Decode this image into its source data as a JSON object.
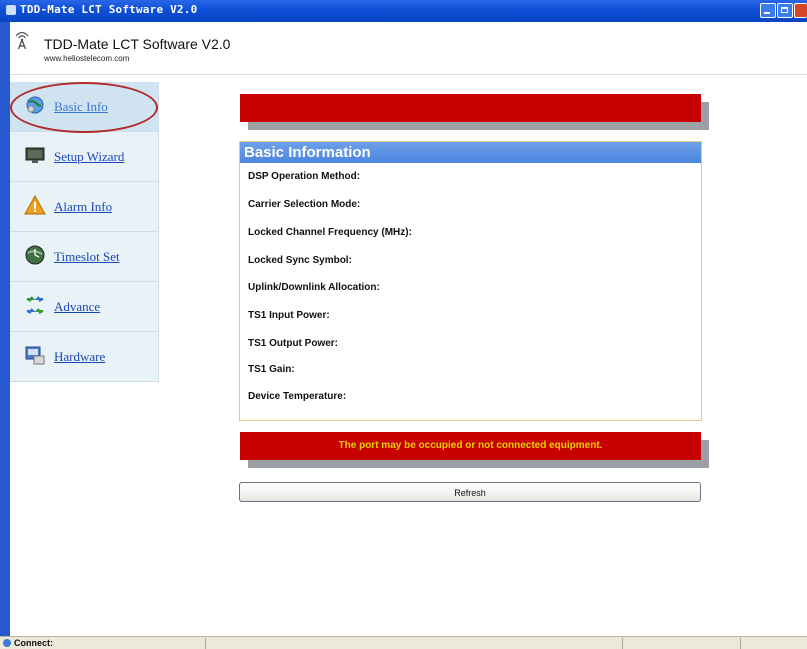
{
  "window": {
    "title": "TDD-Mate LCT Software V2.0"
  },
  "header": {
    "app_title": "TDD-Mate LCT Software V2.0",
    "url": "www.heliostelecom.com"
  },
  "sidebar": {
    "items": [
      {
        "label": "Basic Info",
        "icon": "globe-icon"
      },
      {
        "label": "Setup Wizard",
        "icon": "monitor-icon"
      },
      {
        "label": "Alarm Info",
        "icon": "warning-icon"
      },
      {
        "label": "Timeslot Set",
        "icon": "clock-globe-icon"
      },
      {
        "label": "Advance",
        "icon": "arrows-icon"
      },
      {
        "label": "Hardware",
        "icon": "hardware-icon"
      }
    ],
    "active_index": 0
  },
  "main": {
    "banner_text": "",
    "section_title": "Basic Information",
    "fields": [
      {
        "label": "DSP Operation Method:"
      },
      {
        "label": "Carrier Selection Mode:"
      },
      {
        "label": "Locked Channel Frequency (MHz):"
      },
      {
        "label": "Locked Sync Symbol:"
      },
      {
        "label": "Uplink/Downlink Allocation:"
      },
      {
        "label": "TS1 Input Power:"
      },
      {
        "label": "TS1 Output Power:"
      },
      {
        "label": "TS1 Gain:"
      },
      {
        "label": "Device Temperature:"
      }
    ],
    "error_message": "The port may be occupied or not connected equipment.",
    "refresh_label": "Refresh"
  },
  "statusbar": {
    "text": "Connect:"
  },
  "colors": {
    "titlebar": "#0d4fd6",
    "banner_red": "#c80000",
    "error_text": "#e8d000",
    "header_blue": "#4b86e0",
    "sidebar_bg": "#e8f2f7",
    "highlight_ring": "#b22a2a"
  }
}
